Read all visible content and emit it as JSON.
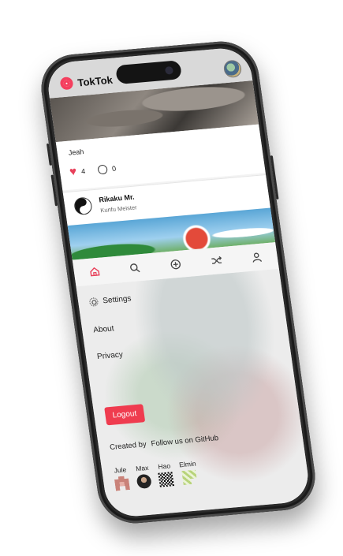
{
  "app": {
    "title": "TokTok"
  },
  "post": {
    "caption": "Jeah",
    "likes": "4",
    "comments": "0"
  },
  "user": {
    "name": "Rikaku Mr.",
    "role": "Kunfu Meister"
  },
  "nav": {
    "icons": [
      "home-icon",
      "search-icon",
      "add-icon",
      "shuffle-icon",
      "profile-icon"
    ]
  },
  "menu": {
    "settings_label": "Settings",
    "about_label": "About",
    "privacy_label": "Privacy",
    "logout_label": "Logout",
    "created_by": "Created by",
    "follow": "Follow us on GitHub"
  },
  "developers": [
    {
      "name": "Jule"
    },
    {
      "name": "Max"
    },
    {
      "name": "Hao"
    },
    {
      "name": "Elmin"
    }
  ],
  "colors": {
    "accent": "#ef3c4f",
    "heart": "#e8405a",
    "header_bg": "#d9d9d9"
  }
}
